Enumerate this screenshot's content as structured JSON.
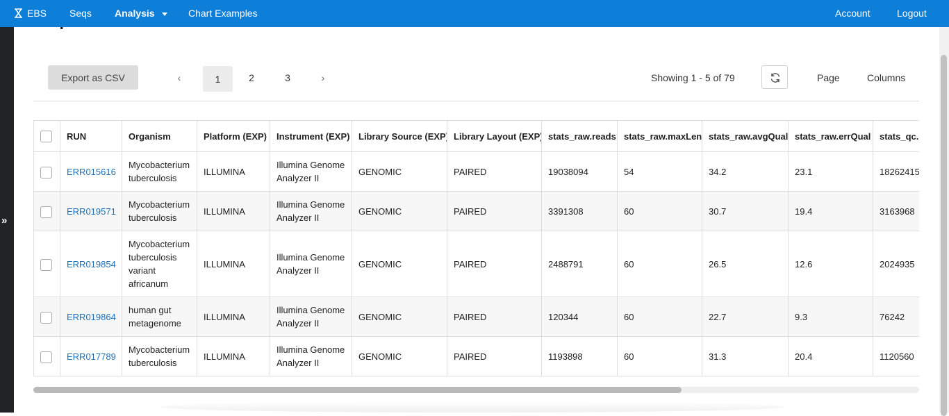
{
  "nav": {
    "brand": "EBS",
    "items": [
      "Seqs",
      "Analysis",
      "Chart Examples"
    ],
    "account": "Account",
    "logout": "Logout"
  },
  "page": {
    "title": "Sequence"
  },
  "toolbar": {
    "export_label": "Export as CSV",
    "pages": [
      "1",
      "2",
      "3"
    ],
    "current_page": "1",
    "prev": "‹",
    "next": "›",
    "showing": "Showing 1 - 5 of 79",
    "page_label": "Page",
    "columns_label": "Columns"
  },
  "table": {
    "columns": [
      "RUN",
      "Organism",
      "Platform (EXP)",
      "Instrument (EXP)",
      "Library Source (EXP)",
      "Library Layout (EXP)",
      "stats_raw.reads",
      "stats_raw.maxLen",
      "stats_raw.avgQual",
      "stats_raw.errQual",
      "stats_qc.reads"
    ],
    "rows": [
      [
        "ERR015616",
        "Mycobacterium tuberculosis",
        "ILLUMINA",
        "Illumina Genome Analyzer II",
        "GENOMIC",
        "PAIRED",
        "19038094",
        "54",
        "34.2",
        "23.1",
        "18262415"
      ],
      [
        "ERR019571",
        "Mycobacterium tuberculosis",
        "ILLUMINA",
        "Illumina Genome Analyzer II",
        "GENOMIC",
        "PAIRED",
        "3391308",
        "60",
        "30.7",
        "19.4",
        "3163968"
      ],
      [
        "ERR019854",
        "Mycobacterium tuberculosis variant africanum",
        "ILLUMINA",
        "Illumina Genome Analyzer II",
        "GENOMIC",
        "PAIRED",
        "2488791",
        "60",
        "26.5",
        "12.6",
        "2024935"
      ],
      [
        "ERR019864",
        "human gut metagenome",
        "ILLUMINA",
        "Illumina Genome Analyzer II",
        "GENOMIC",
        "PAIRED",
        "120344",
        "60",
        "22.7",
        "9.3",
        "76242"
      ],
      [
        "ERR017789",
        "Mycobacterium tuberculosis",
        "ILLUMINA",
        "Illumina Genome Analyzer II",
        "GENOMIC",
        "PAIRED",
        "1193898",
        "60",
        "31.3",
        "20.4",
        "1120560"
      ]
    ]
  },
  "colors": {
    "nav_bg": "#0d7fd9",
    "link": "#1f6fb5",
    "sidebar_bg": "#222326"
  },
  "icons": {
    "brand": "hourglass-icon",
    "refresh": "refresh-icon",
    "sidebar_toggle": "double-chevron-right-icon"
  }
}
